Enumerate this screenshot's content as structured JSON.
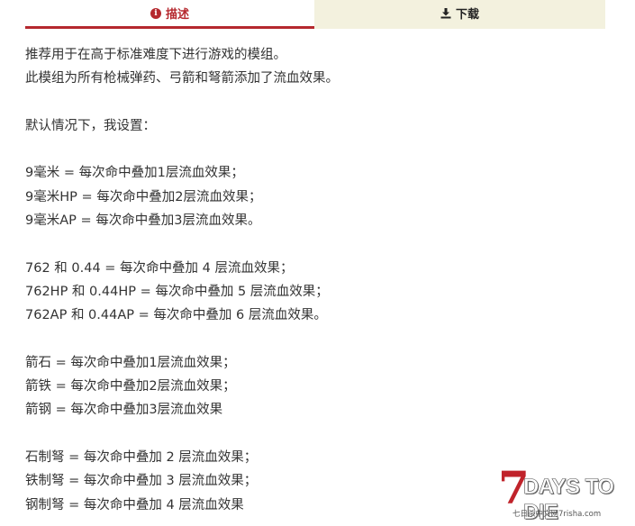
{
  "tabs": {
    "description": "描述",
    "download": "下载"
  },
  "content": {
    "lines": [
      "推荐用于在高于标准难度下进行游戏的模组。",
      "此模组为所有枪械弹药、弓箭和弩箭添加了流血效果。",
      "",
      "默认情况下，我设置：",
      "",
      "9毫米 = 每次命中叠加1层流血效果；",
      "9毫米HP = 每次命中叠加2层流血效果；",
      "9毫米AP = 每次命中叠加3层流血效果。",
      "",
      "762 和 0.44 = 每次命中叠加 4 层流血效果；",
      "762HP 和 0.44HP = 每次命中叠加 5 层流血效果；",
      "762AP 和 0.44AP = 每次命中叠加 6 层流血效果。",
      "",
      "箭石 = 每次命中叠加1层流血效果；",
      "箭铁 = 每次命中叠加2层流血效果；",
      "箭钢 = 每次命中叠加3层流血效果",
      "",
      "石制弩 = 每次命中叠加 2 层流血效果；",
      "铁制弩 = 每次命中叠加 3 层流血效果；",
      "钢制弩 = 每次命中叠加 4 层流血效果"
    ]
  },
  "watermark": {
    "number": "7",
    "title": "DAYS TO DIE",
    "site": "七日杀中文网7risha.com"
  },
  "colors": {
    "accent": "#b5282e",
    "tab_inactive_bg": "#f3f1de",
    "text": "#333333"
  },
  "icons": {
    "description_tab": "info-circle-icon",
    "download_tab": "download-icon"
  }
}
